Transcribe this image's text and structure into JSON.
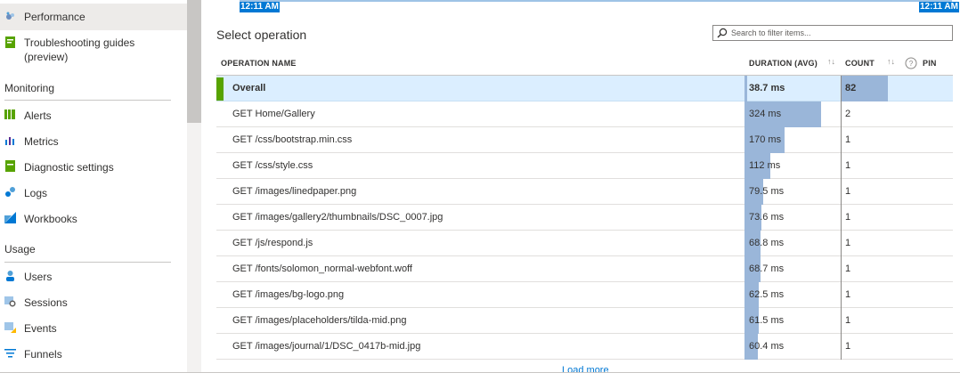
{
  "sidebar": {
    "items": [
      {
        "label": "Performance",
        "icon": "performance-icon"
      },
      {
        "label": "Troubleshooting guides",
        "label2": "(preview)",
        "icon": "guide-icon"
      }
    ],
    "sections": [
      {
        "title": "Monitoring",
        "items": [
          {
            "label": "Alerts",
            "icon": "alerts-icon"
          },
          {
            "label": "Metrics",
            "icon": "metrics-icon"
          },
          {
            "label": "Diagnostic settings",
            "icon": "diagnostic-icon"
          },
          {
            "label": "Logs",
            "icon": "logs-icon"
          },
          {
            "label": "Workbooks",
            "icon": "workbooks-icon"
          }
        ]
      },
      {
        "title": "Usage",
        "items": [
          {
            "label": "Users",
            "icon": "users-icon"
          },
          {
            "label": "Sessions",
            "icon": "sessions-icon"
          },
          {
            "label": "Events",
            "icon": "events-icon"
          },
          {
            "label": "Funnels",
            "icon": "funnels-icon"
          }
        ]
      }
    ]
  },
  "timeline": {
    "start": "12:11 AM",
    "end": "12:11 AM"
  },
  "main": {
    "title": "Select operation",
    "search_placeholder": "Search to filter items...",
    "columns": {
      "name": "OPERATION NAME",
      "duration": "DURATION (AVG)",
      "count": "COUNT",
      "pin": "PIN"
    },
    "sort_glyph": "↑↓",
    "load_more": "Load more"
  },
  "operations": [
    {
      "name": "Overall",
      "duration": "38.7 ms",
      "count": "82",
      "duration_fraction": 0.012,
      "count_fraction": 1.0,
      "selected": true
    },
    {
      "name": "GET Home/Gallery",
      "duration": "324 ms",
      "count": "2",
      "duration_fraction": 1.0,
      "count_fraction": 0.0
    },
    {
      "name": "GET /css/bootstrap.min.css",
      "duration": "170 ms",
      "count": "1",
      "duration_fraction": 0.52,
      "count_fraction": 0.0
    },
    {
      "name": "GET /css/style.css",
      "duration": "112 ms",
      "count": "1",
      "duration_fraction": 0.34,
      "count_fraction": 0.0
    },
    {
      "name": "GET /images/linedpaper.png",
      "duration": "79.5 ms",
      "count": "1",
      "duration_fraction": 0.24,
      "count_fraction": 0.0
    },
    {
      "name": "GET /images/gallery2/thumbnails/DSC_0007.jpg",
      "duration": "73.6 ms",
      "count": "1",
      "duration_fraction": 0.22,
      "count_fraction": 0.0
    },
    {
      "name": "GET /js/respond.js",
      "duration": "68.8 ms",
      "count": "1",
      "duration_fraction": 0.21,
      "count_fraction": 0.0
    },
    {
      "name": "GET /fonts/solomon_normal-webfont.woff",
      "duration": "68.7 ms",
      "count": "1",
      "duration_fraction": 0.21,
      "count_fraction": 0.0
    },
    {
      "name": "GET /images/bg-logo.png",
      "duration": "62.5 ms",
      "count": "1",
      "duration_fraction": 0.19,
      "count_fraction": 0.0
    },
    {
      "name": "GET /images/placeholders/tilda-mid.png",
      "duration": "61.5 ms",
      "count": "1",
      "duration_fraction": 0.19,
      "count_fraction": 0.0
    },
    {
      "name": "GET /images/journal/1/DSC_0417b-mid.jpg",
      "duration": "60.4 ms",
      "count": "1",
      "duration_fraction": 0.18,
      "count_fraction": 0.0
    }
  ]
}
